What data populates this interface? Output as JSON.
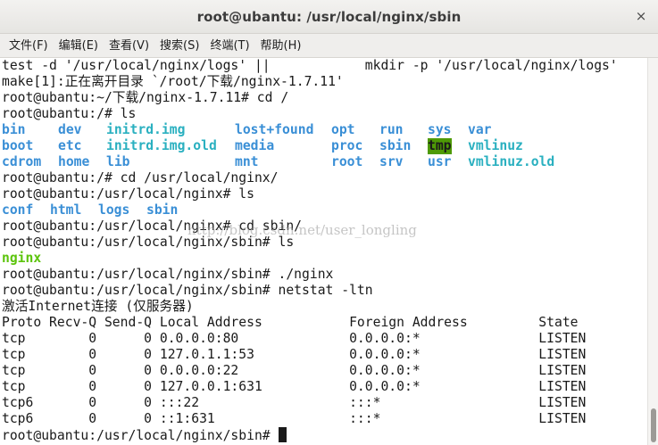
{
  "window": {
    "title": "root@ubantu: /usr/local/nginx/sbin",
    "close_glyph": "×"
  },
  "menu": [
    "文件(F)",
    "编辑(E)",
    "查看(V)",
    "搜索(S)",
    "终端(T)",
    "帮助(H)"
  ],
  "terminal": {
    "lines_top": [
      "test -d '/usr/local/nginx/logs' ||            mkdir -p '/usr/local/nginx/logs'",
      "make[1]:正在离开目录 `/root/下载/nginx-1.7.11'",
      "root@ubantu:~/下载/nginx-1.7.11# cd /",
      "root@ubantu:/# ls"
    ],
    "ls_root": [
      [
        {
          "text": "bin",
          "style": "dir"
        },
        {
          "text": "dev",
          "style": "dir"
        },
        {
          "text": "initrd.img",
          "style": "cyan"
        },
        {
          "text": "lost+found",
          "style": "dir"
        },
        {
          "text": "opt",
          "style": "dir"
        },
        {
          "text": "run",
          "style": "dir"
        },
        {
          "text": "sys",
          "style": "dir"
        },
        {
          "text": "var",
          "style": "dir"
        }
      ],
      [
        {
          "text": "boot",
          "style": "dir"
        },
        {
          "text": "etc",
          "style": "dir"
        },
        {
          "text": "initrd.img.old",
          "style": "cyan"
        },
        {
          "text": "media",
          "style": "dir"
        },
        {
          "text": "proc",
          "style": "dir"
        },
        {
          "text": "sbin",
          "style": "dir"
        },
        {
          "text": "tmp",
          "style": "tmp"
        },
        {
          "text": "vmlinuz",
          "style": "cyan"
        }
      ],
      [
        {
          "text": "cdrom",
          "style": "dir"
        },
        {
          "text": "home",
          "style": "dir"
        },
        {
          "text": "lib",
          "style": "dir"
        },
        {
          "text": "mnt",
          "style": "dir"
        },
        {
          "text": "root",
          "style": "dir"
        },
        {
          "text": "srv",
          "style": "dir"
        },
        {
          "text": "usr",
          "style": "dir"
        },
        {
          "text": "vmlinuz.old",
          "style": "cyan"
        }
      ]
    ],
    "after_root_ls": [
      "root@ubantu:/# cd /usr/local/nginx/",
      "root@ubantu:/usr/local/nginx# ls"
    ],
    "ls_nginx": [
      "conf",
      "html",
      "logs",
      "sbin"
    ],
    "after_nginx_ls": [
      "root@ubantu:/usr/local/nginx# cd sbin/",
      "root@ubantu:/usr/local/nginx/sbin# ls"
    ],
    "ls_sbin": "nginx",
    "after_sbin_ls": [
      "root@ubantu:/usr/local/nginx/sbin# ./nginx",
      "root@ubantu:/usr/local/nginx/sbin# netstat -ltn",
      "激活Internet连接 (仅服务器)",
      "Proto Recv-Q Send-Q Local Address           Foreign Address         State",
      "tcp        0      0 0.0.0.0:80              0.0.0.0:*               LISTEN",
      "tcp        0      0 127.0.1.1:53            0.0.0.0:*               LISTEN",
      "tcp        0      0 0.0.0.0:22              0.0.0.0:*               LISTEN",
      "tcp        0      0 127.0.0.1:631           0.0.0.0:*               LISTEN",
      "tcp6       0      0 :::22                   :::*                    LISTEN",
      "tcp6       0      0 ::1:631                 :::*                    LISTEN"
    ],
    "prompt": "root@ubantu:/usr/local/nginx/sbin# ",
    "watermark": "http://blog.csdn.net/user_longling"
  }
}
